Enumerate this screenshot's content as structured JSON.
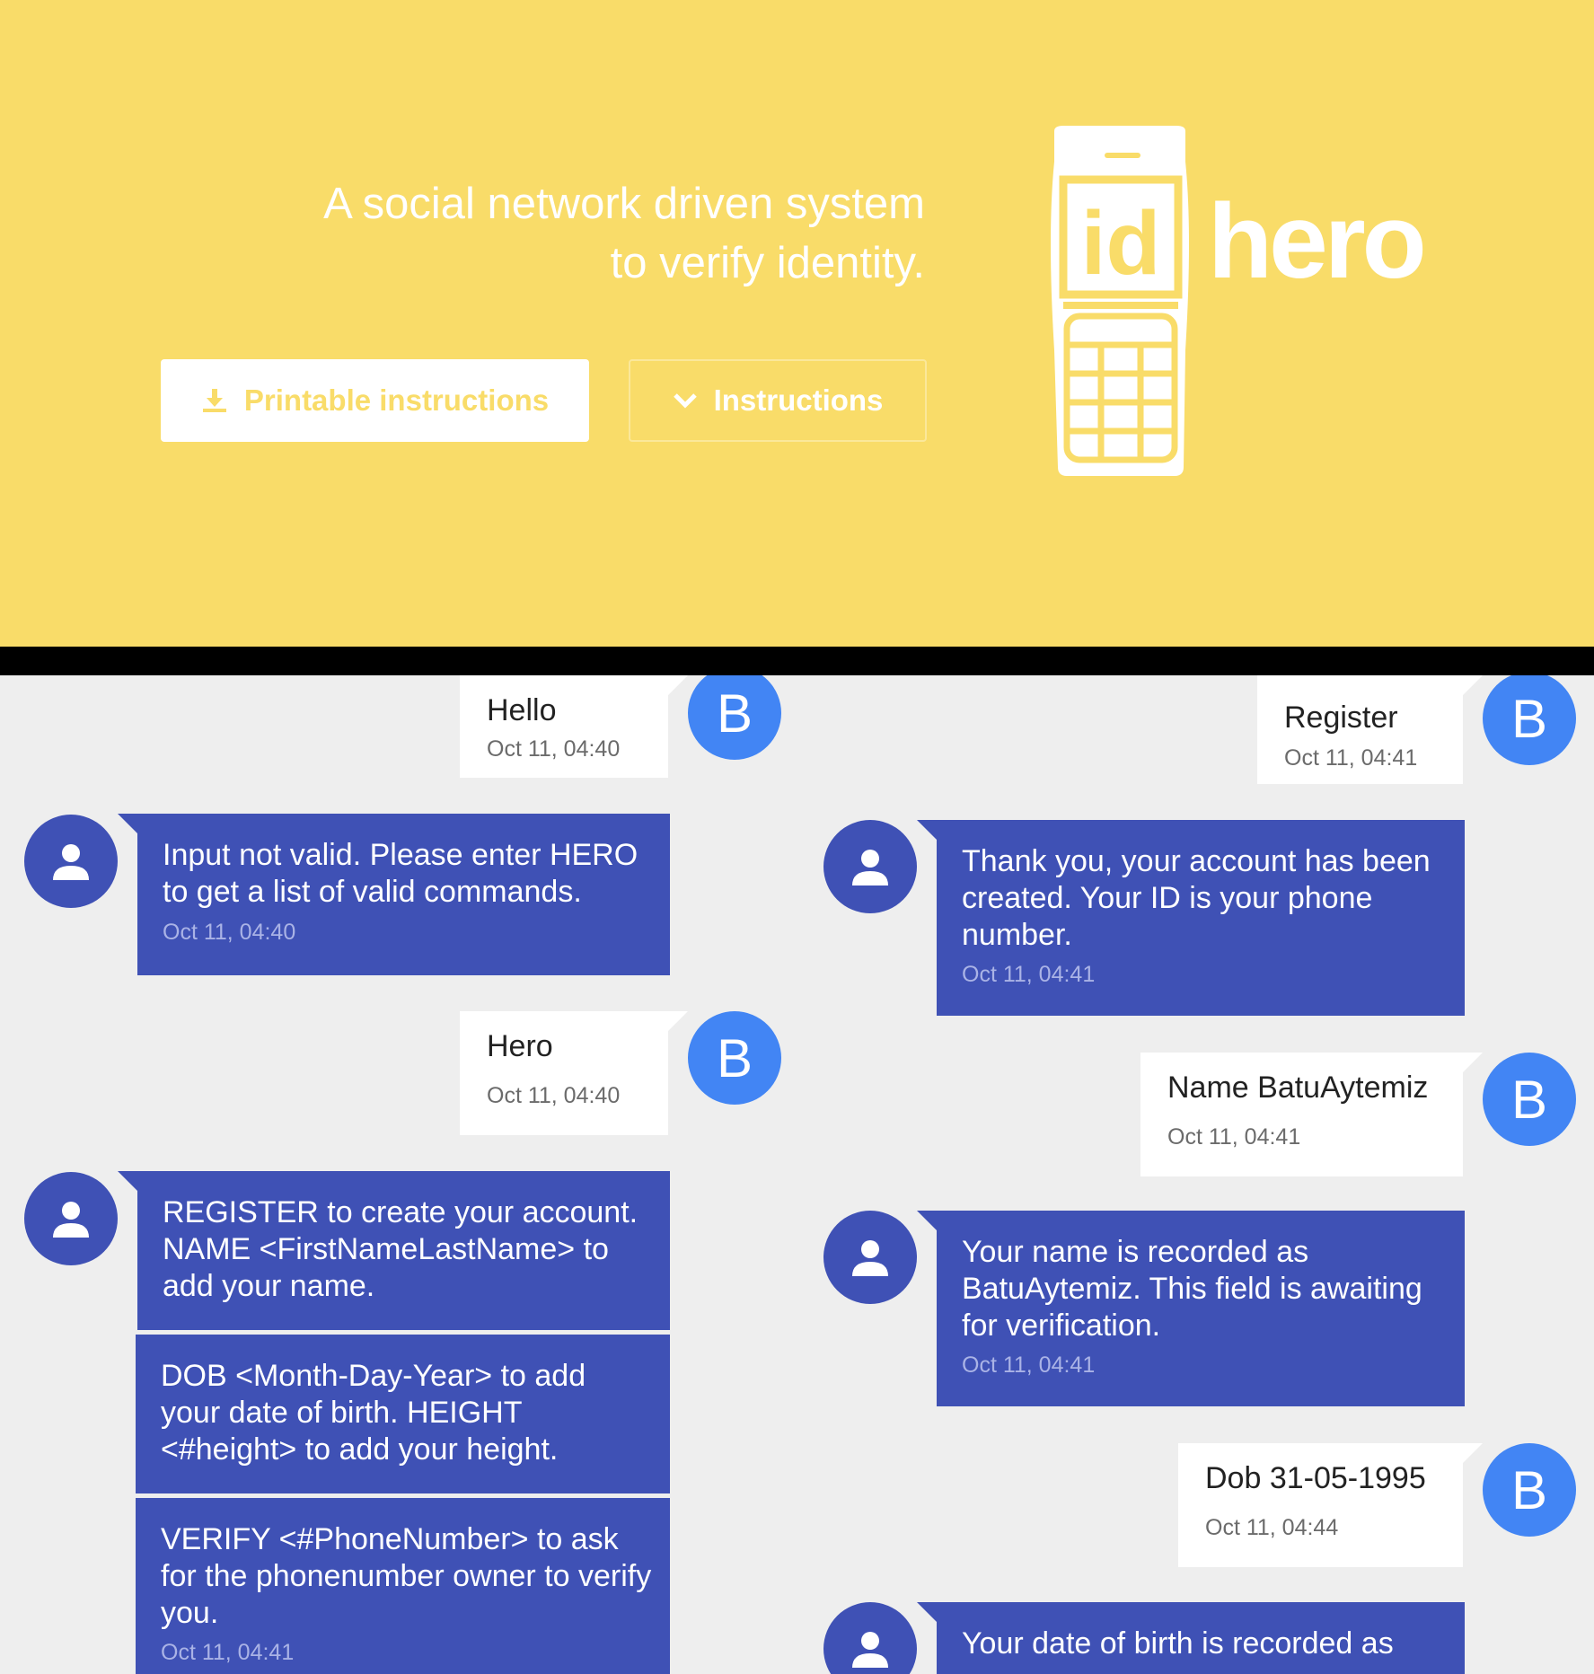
{
  "hero": {
    "tagline_line1": "A social network driven system",
    "tagline_line2": "to verify identity.",
    "printable_button": "Printable instructions",
    "instructions_button": "Instructions",
    "logo_id": "id",
    "logo_hero": "hero",
    "colors": {
      "background": "#f9dc69",
      "text": "#ffffff"
    }
  },
  "chat_left": {
    "messages": [
      {
        "sender": "user",
        "avatar": "B",
        "text": "Hello",
        "time": "Oct 11, 04:40"
      },
      {
        "sender": "bot",
        "text": "Input not valid. Please enter HERO to get a list of valid commands.",
        "time": "Oct 11, 04:40"
      },
      {
        "sender": "user",
        "avatar": "B",
        "text": "Hero",
        "time": "Oct 11, 04:40"
      },
      {
        "sender": "bot",
        "text": "REGISTER to create your account. NAME <FirstNameLastName> to add your name."
      },
      {
        "sender": "bot",
        "text": "DOB <Month-Day-Year> to add your date of birth. HEIGHT <#height> to add your height."
      },
      {
        "sender": "bot",
        "text": "VERIFY <#PhoneNumber> to ask for the phonenumber owner to verify you.",
        "time": "Oct 11, 04:41"
      }
    ]
  },
  "chat_right": {
    "messages": [
      {
        "sender": "user",
        "avatar": "B",
        "text": "Register",
        "time": "Oct 11, 04:41"
      },
      {
        "sender": "bot",
        "text": "Thank you, your account has been created. Your ID is your phone number.",
        "time": "Oct 11, 04:41"
      },
      {
        "sender": "user",
        "avatar": "B",
        "text": "Name BatuAytemiz",
        "time": "Oct 11, 04:41"
      },
      {
        "sender": "bot",
        "text": "Your name is recorded as BatuAytemiz. This field is awaiting for verification.",
        "time": "Oct 11, 04:41"
      },
      {
        "sender": "user",
        "avatar": "B",
        "text": "Dob 31-05-1995",
        "time": "Oct 11, 04:44"
      },
      {
        "sender": "bot",
        "text": "Your date of birth is recorded as"
      }
    ]
  },
  "colors": {
    "bot_bubble": "#3f51b5",
    "user_avatar": "#4285f4",
    "chat_background": "#eeeeee"
  }
}
